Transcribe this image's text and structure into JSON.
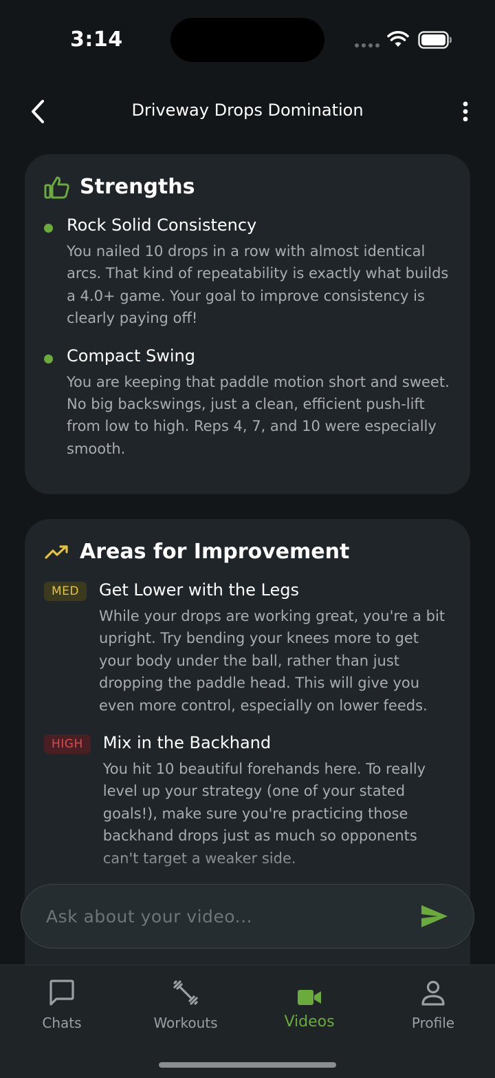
{
  "status_bar": {
    "time": "3:14"
  },
  "header": {
    "title": "Driveway Drops Domination"
  },
  "strengths": {
    "title": "Strengths",
    "items": [
      {
        "title": "Rock Solid Consistency",
        "text": "You nailed 10 drops in a row with almost identical arcs. That kind of repeatability is exactly what builds a 4.0+ game. Your goal to improve consistency is clearly paying off!"
      },
      {
        "title": "Compact Swing",
        "text": "You are keeping that paddle motion short and sweet. No big backswings, just a clean, efficient push-lift from low to high. Reps 4, 7, and 10 were especially smooth."
      }
    ]
  },
  "improvements": {
    "title": "Areas for Improvement",
    "items": [
      {
        "priority": "MED",
        "title": "Get Lower with the Legs",
        "text": "While your drops are working great, you're a bit upright. Try bending your knees more to get your body under the ball, rather than just dropping the paddle head. This will give you even more control, especially on lower feeds."
      },
      {
        "priority": "HIGH",
        "title": "Mix in the Backhand",
        "text": "You hit 10 beautiful forehands here. To really level up your strategy (one of your stated goals!), make sure you're practicing those backhand drops just as much so opponents can't target a weaker side."
      }
    ]
  },
  "chat": {
    "placeholder": "Ask about your video..."
  },
  "nav": {
    "items": [
      {
        "label": "Chats"
      },
      {
        "label": "Workouts"
      },
      {
        "label": "Videos"
      },
      {
        "label": "Profile"
      }
    ],
    "active": "Videos"
  },
  "colors": {
    "accent": "#6aab3c",
    "background": "#131618",
    "card": "#1f2528",
    "med_badge": "#e6c33c",
    "high_badge": "#e0484f",
    "trend_icon": "#e6c33c"
  }
}
